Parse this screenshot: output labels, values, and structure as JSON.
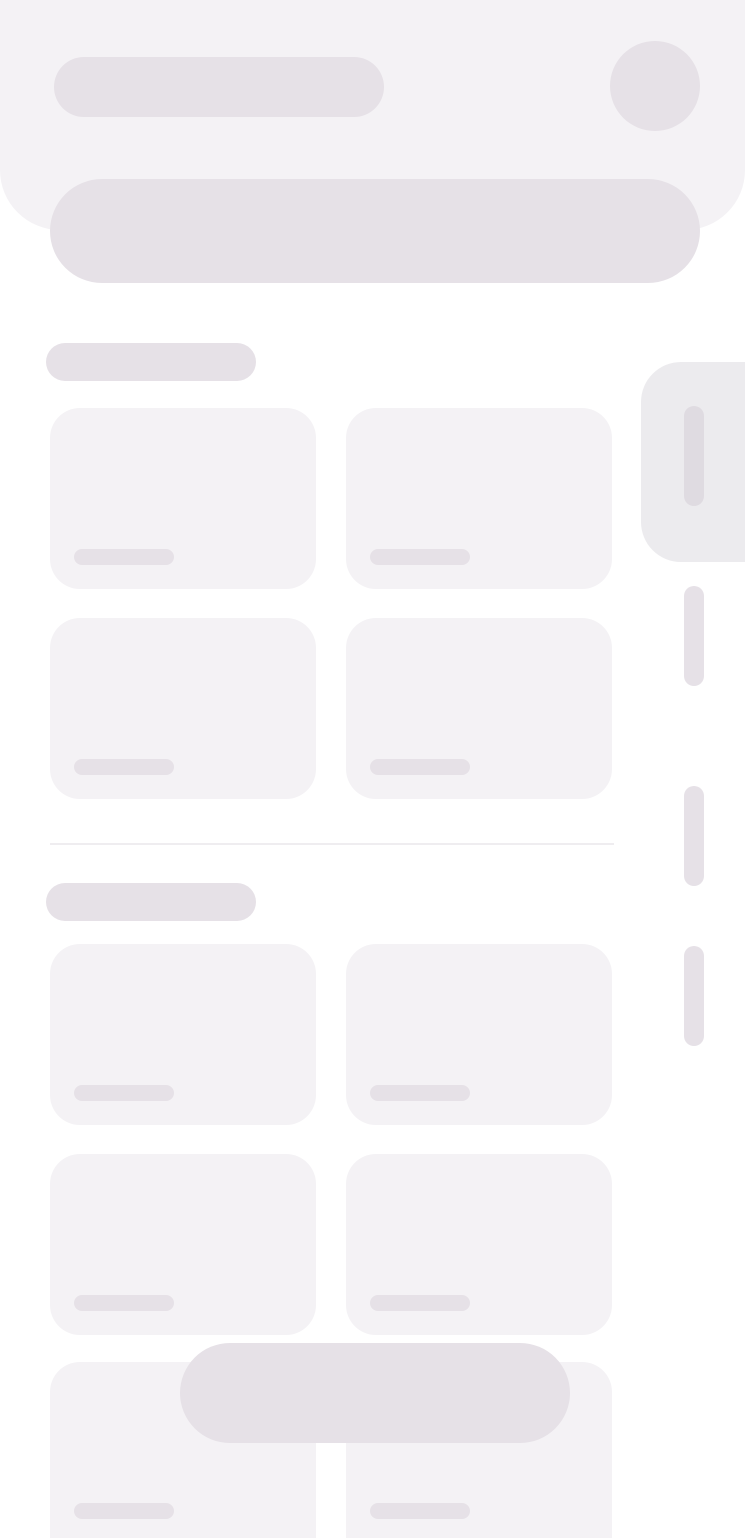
{
  "header": {
    "title": "",
    "search": {
      "placeholder": ""
    }
  },
  "sections": [
    {
      "label": "",
      "cards": [
        "",
        "",
        "",
        ""
      ]
    },
    {
      "label": "",
      "cards": [
        "",
        "",
        "",
        "",
        "",
        ""
      ]
    }
  ],
  "rail": {
    "items": 4,
    "active_index": 0
  },
  "fab": {
    "label": ""
  },
  "colors": {
    "surface": "#f4f2f5",
    "skeleton": "#e6e1e7",
    "rail_active_tab": "#ecebee",
    "background": "#ffffff"
  }
}
